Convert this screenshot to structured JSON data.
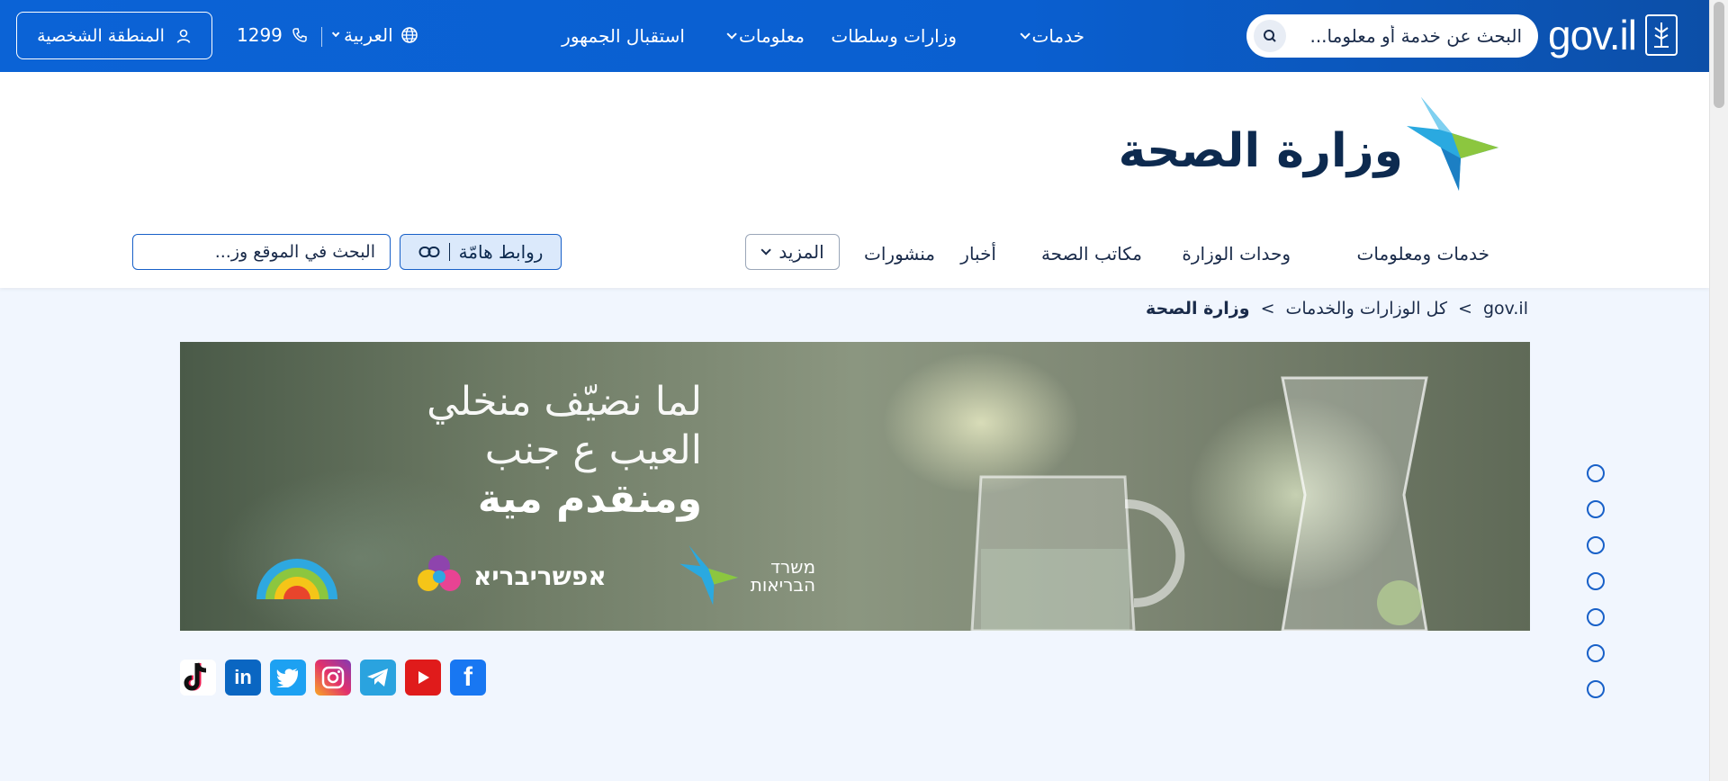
{
  "topbar": {
    "logo_text": "gov.il",
    "search_placeholder": "البحث عن خدمة أو معلوما...",
    "nav": [
      {
        "label": "خدمات",
        "dropdown": true
      },
      {
        "label": "وزارات وسلطات",
        "dropdown": false
      },
      {
        "label": "معلومات",
        "dropdown": true
      },
      {
        "label": "استقبال الجمهور",
        "dropdown": false
      }
    ],
    "language": "العربية",
    "phone": "1299",
    "personal_area": "المنطقة الشخصية"
  },
  "ministry": {
    "title": "وزارة الصحة",
    "subnav": [
      {
        "label": "خدمات ومعلومات"
      },
      {
        "label": "وحدات الوزارة"
      },
      {
        "label": "مكاتب الصحة"
      },
      {
        "label": "أخبار"
      },
      {
        "label": "منشورات"
      }
    ],
    "more_label": "المزيد",
    "links_label": "روابط هامّة",
    "site_search_placeholder": "البحث في الموقع وز..."
  },
  "breadcrumb": {
    "items": [
      "gov.il",
      "كل الوزارات والخدمات",
      "وزارة الصحة"
    ],
    "separator": ">"
  },
  "banner": {
    "line1": "لما نضيّف منخلي",
    "line2": "العيب ع جنب",
    "line3": "ومنقدم مية",
    "brand_left": "אפשריבריא",
    "brand_ministry_line1": "משרד",
    "brand_ministry_line2": "הבריאות"
  },
  "social": [
    {
      "name": "tiktok",
      "glyph": "♪",
      "color": "#111111"
    },
    {
      "name": "linkedin",
      "glyph": "in",
      "color": "#0a66c2"
    },
    {
      "name": "twitter",
      "glyph": "🐦",
      "color": "#1da1f2"
    },
    {
      "name": "instagram",
      "glyph": "◎",
      "color": "#c13584"
    },
    {
      "name": "telegram",
      "glyph": "➤",
      "color": "#2aa3df"
    },
    {
      "name": "youtube",
      "glyph": "▶",
      "color": "#e01b1b"
    },
    {
      "name": "facebook",
      "glyph": "f",
      "color": "#1877f2"
    }
  ],
  "slider_dots": 7,
  "colors": {
    "brand_blue": "#0b63d6",
    "navy_text": "#0d2a4f",
    "page_bg": "#f1f6fe"
  }
}
